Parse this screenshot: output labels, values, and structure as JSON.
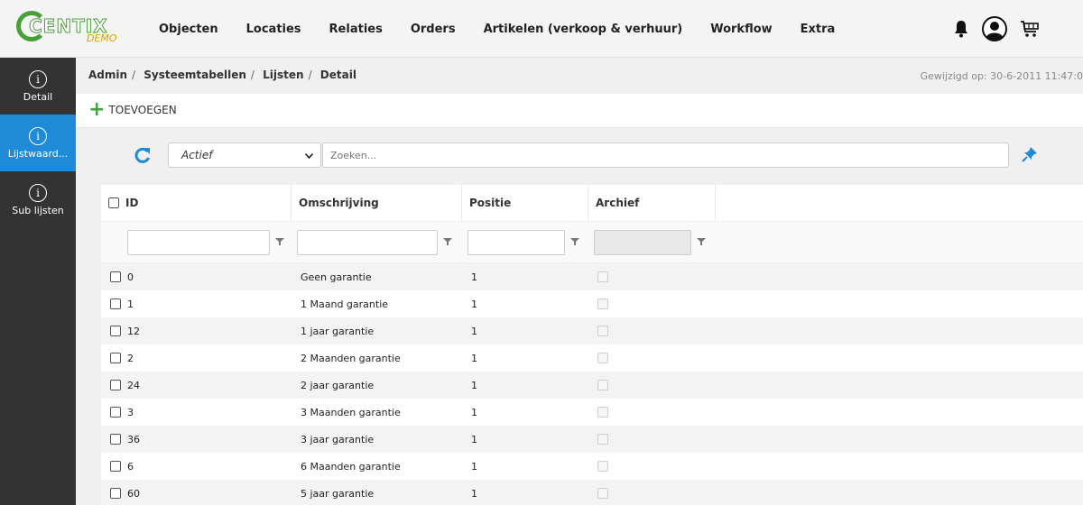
{
  "brand": {
    "name": "CENTIX",
    "sub": "DEMO"
  },
  "nav": [
    "Objecten",
    "Locaties",
    "Relaties",
    "Orders",
    "Artikelen (verkoop & verhuur)",
    "Workflow",
    "Extra"
  ],
  "sidebar": [
    {
      "label": "Detail",
      "active": false
    },
    {
      "label": "Lijstwaard...",
      "active": true
    },
    {
      "label": "Sub lijsten",
      "active": false
    }
  ],
  "breadcrumb": [
    "Admin",
    "Systeemtabellen",
    "Lijsten",
    "Detail"
  ],
  "modified": "Gewijzigd op: 30-6-2011 11:47:0",
  "actions": {
    "add_label": "TOEVOEGEN"
  },
  "filter": {
    "status_value": "Actief",
    "search_placeholder": "Zoeken..."
  },
  "table": {
    "columns": [
      "ID",
      "Omschrijving",
      "Positie",
      "Archief"
    ],
    "rows": [
      {
        "id": "0",
        "omschrijving": "Geen garantie",
        "positie": "1"
      },
      {
        "id": "1",
        "omschrijving": "1 Maand garantie",
        "positie": "1"
      },
      {
        "id": "12",
        "omschrijving": "1 jaar garantie",
        "positie": "1"
      },
      {
        "id": "2",
        "omschrijving": "2 Maanden garantie",
        "positie": "1"
      },
      {
        "id": "24",
        "omschrijving": "2 jaar garantie",
        "positie": "1"
      },
      {
        "id": "3",
        "omschrijving": "3 Maanden garantie",
        "positie": "1"
      },
      {
        "id": "36",
        "omschrijving": "3 jaar garantie",
        "positie": "1"
      },
      {
        "id": "6",
        "omschrijving": "6 Maanden garantie",
        "positie": "1"
      },
      {
        "id": "60",
        "omschrijving": "5 jaar garantie",
        "positie": "1"
      }
    ]
  },
  "colors": {
    "accent": "#1e8ad8",
    "add_green": "#3fa63f",
    "sidebar_bg": "#333333",
    "flag_red": "#ae1c28",
    "flag_blue": "#21468b"
  },
  "icons": {
    "top": [
      "bell-icon",
      "user-avatar-icon",
      "cart-icon",
      "flag-nl-icon"
    ],
    "refresh": "refresh-icon",
    "pin": "pin-icon"
  }
}
